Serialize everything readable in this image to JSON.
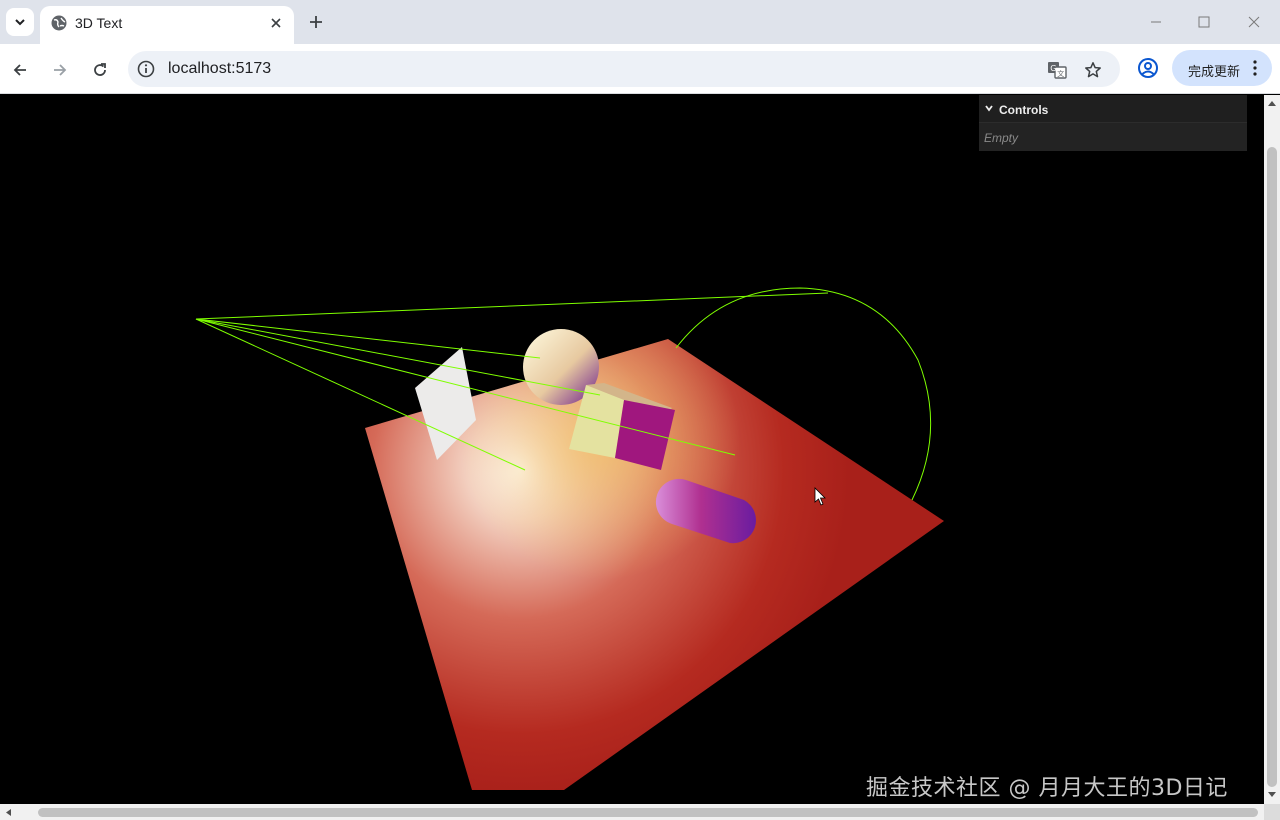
{
  "browser": {
    "tab_title": "3D Text",
    "url": "localhost:5173",
    "update_button_label": "完成更新"
  },
  "gui": {
    "title": "Controls",
    "empty_label": "Empty"
  },
  "watermark": "掘金技术社区 @ 月月大王的3D日记",
  "colors": {
    "plane": "#c0231e",
    "helper_lines": "#7fff00",
    "gui_bg": "#1f1f1f",
    "update_button": "#d3e3fd"
  },
  "icons": [
    "tab-search-icon",
    "globe-icon",
    "close-icon",
    "plus-icon",
    "minimize-icon",
    "maximize-icon",
    "back-icon",
    "forward-icon",
    "reload-icon",
    "info-icon",
    "translate-icon",
    "star-icon",
    "profile-icon",
    "more-vertical-icon",
    "chevron-down-icon",
    "cursor-icon"
  ]
}
